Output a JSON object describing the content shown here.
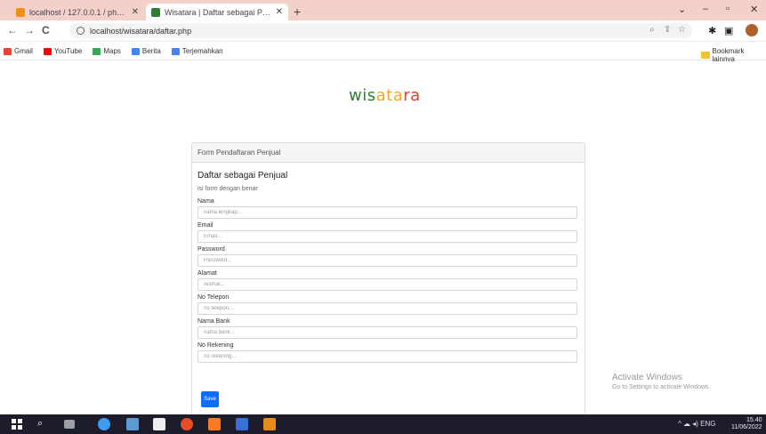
{
  "browser": {
    "tabs": [
      {
        "title": "localhost / 127.0.0.1 / phpMyAdmin",
        "active": false,
        "favicon_color": "#f29111"
      },
      {
        "title": "Wisatara | Daftar sebagai Penjual",
        "active": true,
        "favicon_color": "#2f7d32"
      }
    ],
    "new_tab_label": "+",
    "window_controls": {
      "menu": "⌄",
      "minimize": "–",
      "maximize": "▫",
      "close": "✕"
    },
    "nav": {
      "back": "←",
      "forward": "→",
      "reload": "C"
    },
    "address": "localhost/wisatara/daftar.php",
    "bookmarks": [
      {
        "label": "Gmail",
        "color": "#ea4335"
      },
      {
        "label": "YouTube",
        "color": "#ff0000"
      },
      {
        "label": "Maps",
        "color": "#34a853"
      },
      {
        "label": "Berita",
        "color": "#4285f4"
      },
      {
        "label": "Terjemahkan",
        "color": "#4285f4"
      }
    ],
    "other_bookmarks": "Bookmark lainnya"
  },
  "page": {
    "logo": {
      "part1": "wis",
      "part2": "ata",
      "part3": "ra"
    },
    "card": {
      "header": "Form Pendaftaran Penjual",
      "title": "Daftar sebagai Penjual",
      "subtitle": "isi form dengan benar",
      "fields": [
        {
          "label": "Nama",
          "placeholder": "nama lengkap..."
        },
        {
          "label": "Email",
          "placeholder": "Email..."
        },
        {
          "label": "Password",
          "placeholder": "Password..."
        },
        {
          "label": "Alamat",
          "placeholder": "Alamat..."
        },
        {
          "label": "No Telepon",
          "placeholder": "no telepon..."
        },
        {
          "label": "Nama Bank",
          "placeholder": "nama bank..."
        },
        {
          "label": "No Rekening",
          "placeholder": "no rekening..."
        }
      ],
      "submit_label": "Save"
    },
    "watermark": {
      "line1": "Activate Windows",
      "line2": "Go to Settings to activate Windows."
    }
  },
  "taskbar": {
    "apps": [
      {
        "name": "task-view",
        "color": "#9aa0a6"
      },
      {
        "name": "edge",
        "color": "#3b9cf0"
      },
      {
        "name": "mail",
        "color": "#5b9bd5"
      },
      {
        "name": "store",
        "color": "#eeeeee"
      },
      {
        "name": "chrome",
        "color": "#e44d26"
      },
      {
        "name": "xampp",
        "color": "#fb7a24"
      },
      {
        "name": "app-blue",
        "color": "#3a6fd8"
      },
      {
        "name": "app-orange",
        "color": "#e98b1b"
      }
    ],
    "tray": "^ ☁ ◂) ENG",
    "time": "15.40",
    "date": "11/06/2022"
  }
}
